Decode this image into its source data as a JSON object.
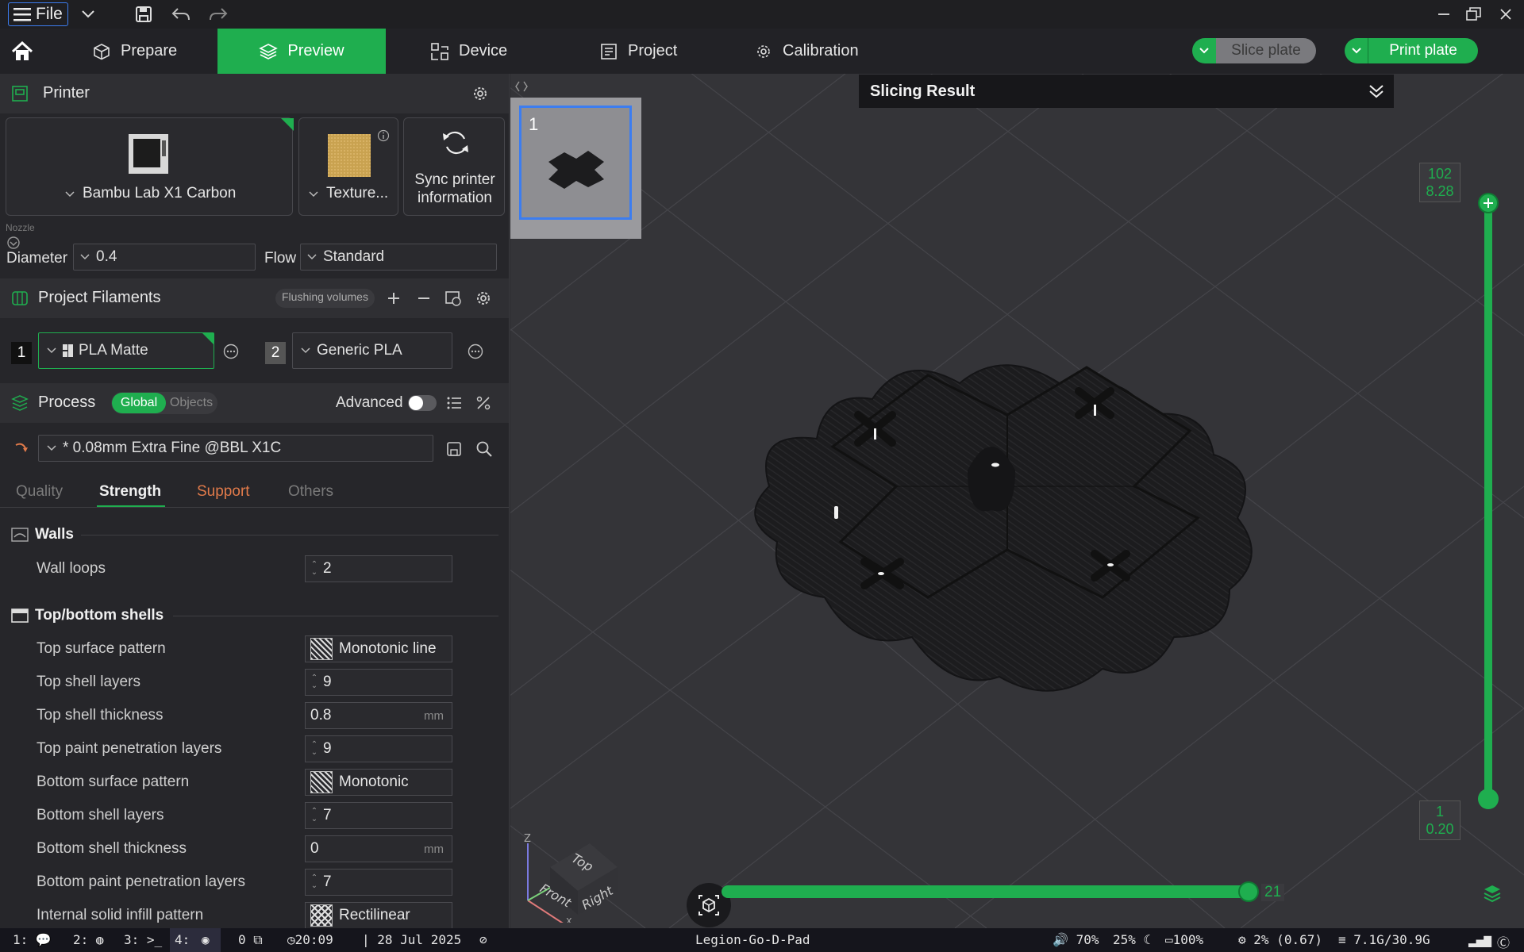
{
  "titlebar": {
    "file_label": "File",
    "icons": [
      "menu-icon",
      "chevron-down-icon",
      "save-icon",
      "undo-icon",
      "redo-icon",
      "minimize-icon",
      "restore-icon",
      "close-icon"
    ]
  },
  "tabs": [
    {
      "label": "Prepare",
      "icon": "cube-icon",
      "active": false
    },
    {
      "label": "Preview",
      "icon": "layers-icon",
      "active": true
    },
    {
      "label": "Device",
      "icon": "device-icon",
      "active": false
    },
    {
      "label": "Project",
      "icon": "project-icon",
      "active": false
    },
    {
      "label": "Calibration",
      "icon": "calibration-icon",
      "active": false
    }
  ],
  "actions": {
    "slice_plate": "Slice plate",
    "print_plate": "Print plate"
  },
  "printer": {
    "section_title": "Printer",
    "name": "Bambu Lab X1 Carbon",
    "plate": "Texture...",
    "sync_label": "Sync printer information",
    "nozzle_caption": "Nozzle",
    "diameter_label": "Diameter",
    "diameter_value": "0.4",
    "flow_label": "Flow",
    "flow_value": "Standard"
  },
  "filaments": {
    "section_title": "Project Filaments",
    "flushing_label": "Flushing volumes",
    "items": [
      {
        "index": "1",
        "name": "PLA Matte",
        "color": "#1a1a1a"
      },
      {
        "index": "2",
        "name": "Generic PLA",
        "color": "#555555"
      }
    ]
  },
  "process": {
    "section_title": "Process",
    "toggle_global": "Global",
    "toggle_objects": "Objects",
    "advanced_label": "Advanced",
    "preset": "* 0.08mm Extra Fine @BBL X1C",
    "subtabs": [
      "Quality",
      "Strength",
      "Support",
      "Others"
    ],
    "active_subtab": "Strength"
  },
  "settings": {
    "walls_title": "Walls",
    "wall_loops_label": "Wall loops",
    "wall_loops_value": "2",
    "shells_title": "Top/bottom shells",
    "rows": [
      {
        "label": "Top surface pattern",
        "value": "Monotonic line",
        "kind": "pattern"
      },
      {
        "label": "Top shell layers",
        "value": "9",
        "kind": "spin"
      },
      {
        "label": "Top shell thickness",
        "value": "0.8",
        "kind": "unit",
        "unit": "mm"
      },
      {
        "label": "Top paint penetration layers",
        "value": "9",
        "kind": "spin"
      },
      {
        "label": "Bottom surface pattern",
        "value": "Monotonic",
        "kind": "pattern"
      },
      {
        "label": "Bottom shell layers",
        "value": "7",
        "kind": "spin"
      },
      {
        "label": "Bottom shell thickness",
        "value": "0",
        "kind": "unit",
        "unit": "mm"
      },
      {
        "label": "Bottom paint penetration layers",
        "value": "7",
        "kind": "spin"
      },
      {
        "label": "Internal solid infill pattern",
        "value": "Rectilinear",
        "kind": "pattern-grid"
      }
    ]
  },
  "viewport": {
    "plate_number": "1",
    "slicing_result_title": "Slicing Result",
    "layer_top_index": "102",
    "layer_top_height": "8.28",
    "layer_bottom_index": "1",
    "layer_bottom_height": "0.20",
    "horizontal_move_value": "21",
    "horizontal_slider_fraction": 1.0,
    "vertical_slider_fraction": 1.0,
    "cube_labels": {
      "top": "Top",
      "front": "Front",
      "right": "Right",
      "z": "Z",
      "x": "X"
    }
  },
  "statusbar": {
    "workspaces": [
      "1:",
      "2:",
      "3:",
      "4:"
    ],
    "windows_count": "0",
    "time": "20:09",
    "date": "| 28 Jul 2025",
    "host": "Legion-Go-D-Pad",
    "volume": "70%",
    "brightness": "25%",
    "battery": "100%",
    "cpu": "2% (0.67)",
    "memory": "7.1G/30.9G"
  },
  "colors": {
    "accent": "#1fae4f",
    "selection": "#3c7df0",
    "support_orange": "#e07a4a"
  }
}
